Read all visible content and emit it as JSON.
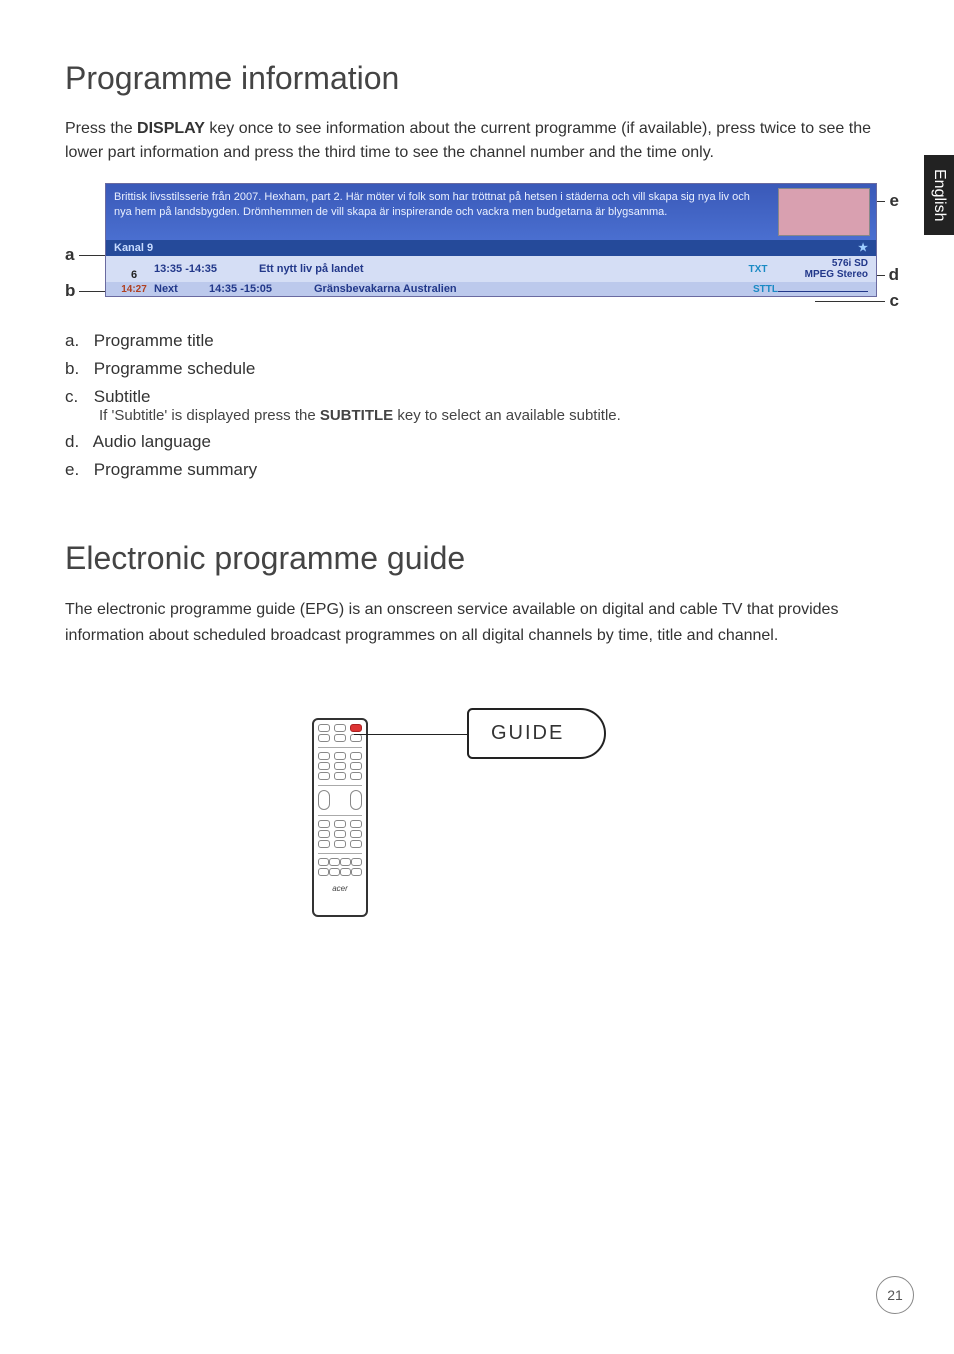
{
  "sideTab": "English",
  "section1": {
    "title": "Programme information",
    "intro_prefix": "Press the ",
    "intro_key": "DISPLAY",
    "intro_suffix": " key once to see information about the current programme (if available), press twice to see the lower part information and press the third time to see the channel number and the time only."
  },
  "osd": {
    "summary": "Brittisk livsstilsserie från 2007. Hexham, part 2. Här möter vi folk som har tröttnat på hetsen i städerna och vill skapa sig nya liv och nya hem på landsbygden. Drömhemmen de vill skapa är inspirerande och vackra men budgetarna är blygsamma.",
    "channel": "Kanal 9",
    "row1": {
      "num": "6",
      "time": "13:35 -14:35",
      "title": "Ett nytt liv på landet",
      "txt": "TXT",
      "video": "576i SD",
      "audio": "MPEG Stereo"
    },
    "row2": {
      "clock": "14:27",
      "next": "Next",
      "time": "14:35 -15:05",
      "title": "Gränsbevakarna Australien",
      "sttl": "STTL"
    }
  },
  "callouts": {
    "a": "a",
    "b": "b",
    "c": "c",
    "d": "d",
    "e": "e"
  },
  "legend": {
    "a": {
      "key": "a.",
      "text": "Programme title"
    },
    "b": {
      "key": "b.",
      "text": "Programme schedule"
    },
    "c": {
      "key": "c.",
      "text": "Subtitle",
      "sub_prefix": "If 'Subtitle' is displayed press the ",
      "sub_key": "SUBTITLE",
      "sub_suffix": " key to select an available subtitle."
    },
    "d": {
      "key": "d.",
      "text": "Audio language"
    },
    "e": {
      "key": "e.",
      "text": "Programme summary"
    }
  },
  "section2": {
    "title": "Electronic programme guide",
    "intro": "The electronic programme guide (EPG) is an onscreen service available on digital and cable TV that provides information about scheduled broadcast programmes on all digital channels by time, title and channel.",
    "balloon": "GUIDE",
    "remote_brand": "acer"
  },
  "pageNumber": "21"
}
